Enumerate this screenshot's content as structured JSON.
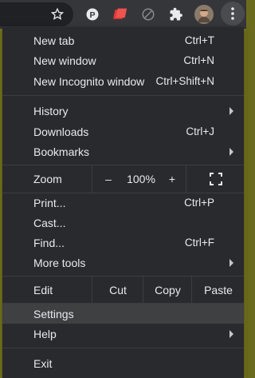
{
  "toolbar": {
    "icons": [
      "bookmark-star-icon",
      "pinterest-icon",
      "red-extension-icon",
      "blocked-extension-icon",
      "extensions-puzzle-icon",
      "profile-avatar",
      "menu-kebab-icon"
    ]
  },
  "menu": {
    "new_tab": {
      "label": "New tab",
      "shortcut": "Ctrl+T"
    },
    "new_window": {
      "label": "New window",
      "shortcut": "Ctrl+N"
    },
    "new_incognito": {
      "label": "New Incognito window",
      "shortcut": "Ctrl+Shift+N"
    },
    "history": {
      "label": "History"
    },
    "downloads": {
      "label": "Downloads",
      "shortcut": "Ctrl+J"
    },
    "bookmarks": {
      "label": "Bookmarks"
    },
    "zoom": {
      "label": "Zoom",
      "minus": "–",
      "value": "100%",
      "plus": "+"
    },
    "print": {
      "label": "Print...",
      "shortcut": "Ctrl+P"
    },
    "cast": {
      "label": "Cast..."
    },
    "find": {
      "label": "Find...",
      "shortcut": "Ctrl+F"
    },
    "more_tools": {
      "label": "More tools"
    },
    "edit": {
      "label": "Edit",
      "cut": "Cut",
      "copy": "Copy",
      "paste": "Paste"
    },
    "settings": {
      "label": "Settings"
    },
    "help": {
      "label": "Help"
    },
    "exit": {
      "label": "Exit"
    }
  },
  "colors": {
    "menu_bg": "#292a2d",
    "toolbar_bg": "#35363a",
    "text": "#e8eaed",
    "highlight": "#3f4042"
  }
}
